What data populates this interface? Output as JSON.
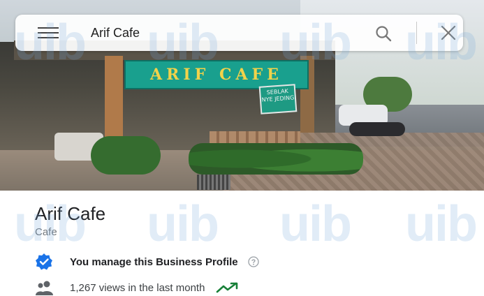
{
  "search": {
    "query": "Arif Cafe"
  },
  "photo": {
    "sign_text": "ARIF CAFE",
    "side_sign_text": "SEBLAK NYE JEDING"
  },
  "place": {
    "name": "Arif Cafe",
    "category": "Cafe",
    "manage_text": "You manage this Business Profile",
    "views_text": "1,267 views in the last month"
  },
  "watermark": "uib",
  "icons": {
    "menu": "menu-icon",
    "search": "search-icon",
    "close": "close-icon",
    "verified": "verified-badge-icon",
    "help": "help-icon",
    "people": "people-icon",
    "trend": "trending-up-icon"
  },
  "colors": {
    "verified_blue": "#1a73e8",
    "trend_green": "#188038",
    "watermark": "#78aadc"
  }
}
